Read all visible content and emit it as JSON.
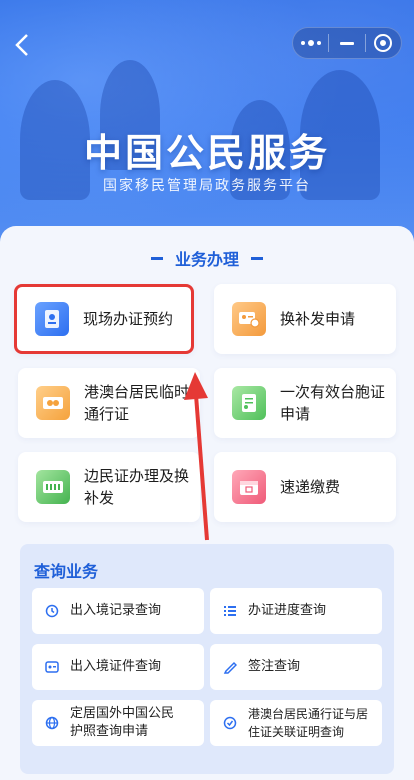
{
  "header": {
    "title": "中国公民服务",
    "subtitle": "国家移民管理局政务服务平台"
  },
  "capsule_icons": [
    "more-icon",
    "minimize-icon",
    "close-target-icon"
  ],
  "services": {
    "section_title": "业务办理",
    "items": [
      {
        "label": "现场办证预约",
        "icon": "passport-icon"
      },
      {
        "label": "换补发申请",
        "icon": "id-card-swap-icon"
      },
      {
        "label_line1": "港澳台居民临时",
        "label_line2": "通行证",
        "icon": "travel-permit-icon"
      },
      {
        "label_line1": "一次有效台胞证",
        "label_line2": "申请",
        "icon": "certificate-icon"
      },
      {
        "label_line1": "边民证办理及换",
        "label_line2": "补发",
        "icon": "border-permit-icon"
      },
      {
        "label": "速递缴费",
        "icon": "express-box-icon"
      }
    ]
  },
  "query": {
    "section_title": "查询业务",
    "items": [
      {
        "label": "出入境记录查询",
        "icon": "history-icon"
      },
      {
        "label": "办证进度查询",
        "icon": "progress-list-icon"
      },
      {
        "label": "出入境证件查询",
        "icon": "document-card-icon"
      },
      {
        "label": "签注查询",
        "icon": "stamp-icon"
      },
      {
        "label_line1": "定居国外中国公民",
        "label_line2": "护照查询申请",
        "icon": "globe-icon"
      },
      {
        "label_line1": "港澳台居民通行证与居",
        "label_line2": "住证关联证明查询",
        "icon": "link-badge-icon"
      }
    ]
  },
  "colors": {
    "accent": "#1f5fd8",
    "highlight": "#e53935",
    "hero": "#3a7bef"
  }
}
